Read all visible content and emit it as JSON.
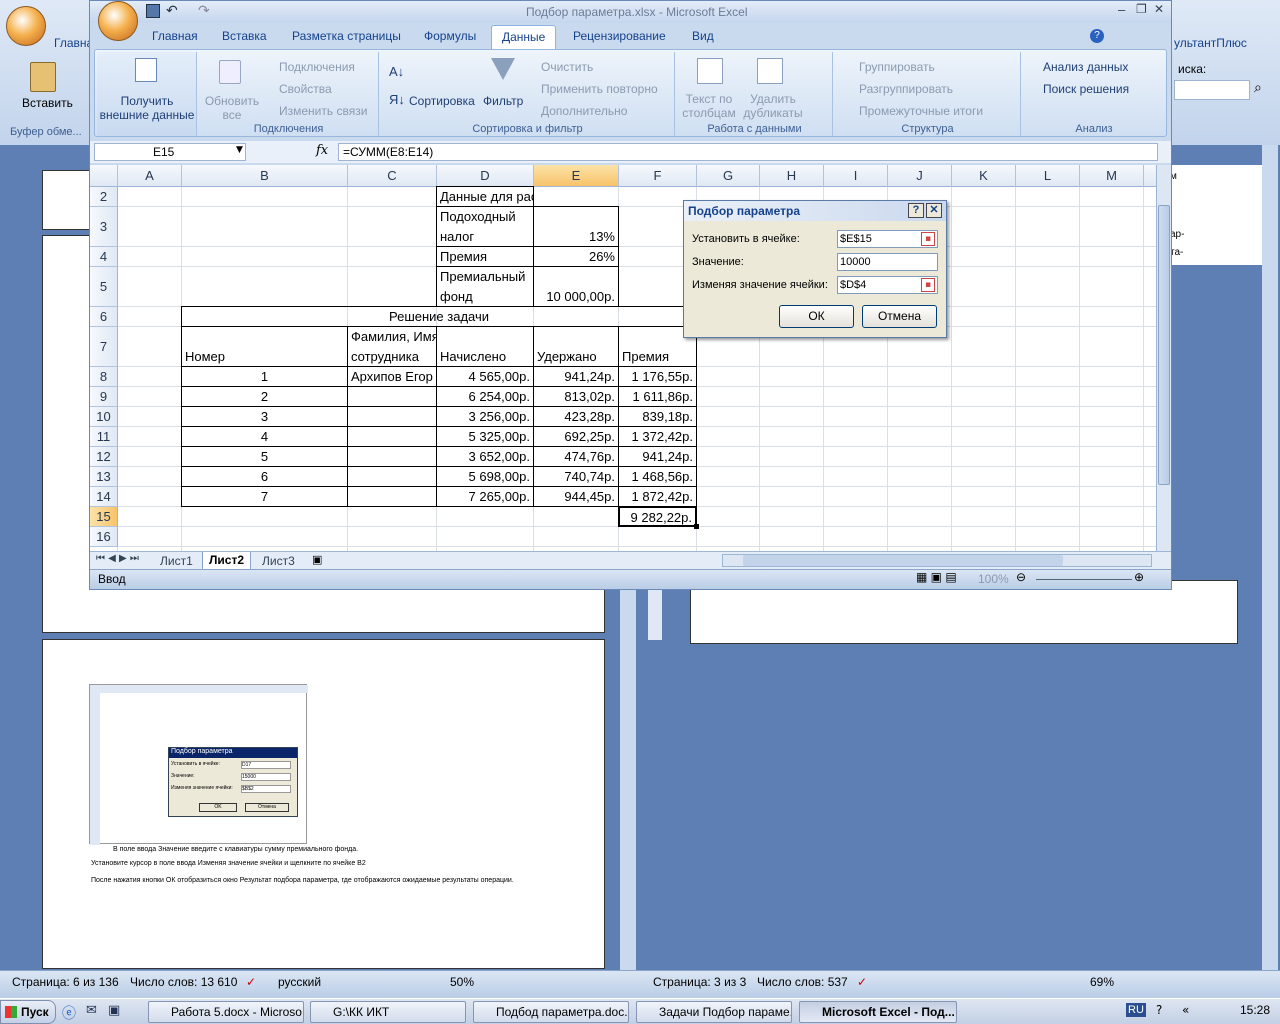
{
  "word_left": {
    "tab_home": "Главна",
    "paste_label": "Вставить",
    "clipboard_label": "Буфер обме...",
    "status": {
      "page": "Страница: 6 из 136",
      "words": "Число слов: 13 610",
      "language": "русский",
      "zoom": "50%"
    },
    "thumb": {
      "dialog_title": "Подбор параметра",
      "set_cell_label": "Установить в ячейке:",
      "set_cell_value": "D17",
      "value_label": "Значение:",
      "value_value": "15000",
      "changing_label": "Изменяя значение ячейки:",
      "changing_value": "$B$2",
      "ok": "OK",
      "cancel": "Отмена",
      "text1": "В поле ввода Значение введите с клавиатуры сумму премиального фонда.",
      "text2": "Установите курсор в поле ввода Изменяя значение ячейки и щелкните по ячейке В2",
      "text3": "После нажатия кнопки ОК отобразиться окно Результат подбора параметра, где отображаются ожидаемые результаты операции."
    }
  },
  "word_right": {
    "tab_frag": "ультантПлюс",
    "search_frag": "иска:",
    "side_text": [
      "м",
      "ар-",
      "та-"
    ],
    "status": {
      "page": "Страница: 3 из 3",
      "words": "Число слов: 537",
      "zoom": "69%"
    }
  },
  "excel": {
    "title": "Подбор параметра.xlsx - Microsoft Excel",
    "tabs": [
      "Главная",
      "Вставка",
      "Разметка страницы",
      "Формулы",
      "Данные",
      "Рецензирование",
      "Вид"
    ],
    "active_tab": "Данные",
    "ribbon": {
      "get_external": "Получить внешние данные",
      "refresh_all": "Обновить все",
      "connections": "Подключения",
      "properties": "Свойства",
      "edit_links": "Изменить связи",
      "group_connections": "Подключения",
      "sort": "Сортировка",
      "filter": "Фильтр",
      "clear": "Очистить",
      "reapply": "Применить повторно",
      "advanced": "Дополнительно",
      "group_sort": "Сортировка и фильтр",
      "text_to_columns": "Текст по столбцам",
      "remove_duplicates": "Удалить дубликаты",
      "group_data_tools": "Работа с данными",
      "group": "Группировать",
      "ungroup": "Разгруппировать",
      "subtotal": "Промежуточные итоги",
      "group_outline": "Структура",
      "data_analysis": "Анализ данных",
      "solver": "Поиск решения",
      "group_analysis": "Анализ"
    },
    "name_box": "E15",
    "fx": "fx",
    "formula": "=СУММ(E8:E14)",
    "columns": [
      "A",
      "B",
      "C",
      "D",
      "E",
      "F",
      "G",
      "H",
      "I",
      "J",
      "K",
      "L",
      "M",
      "N"
    ],
    "rows": [
      "2",
      "3",
      "4",
      "5",
      "6",
      "7",
      "8",
      "9",
      "10",
      "11",
      "12",
      "13",
      "14",
      "15",
      "16"
    ],
    "cells": {
      "c2": "Данные для расчетов",
      "c3a": "Подоходный",
      "c3b": "налог",
      "d3": "13%",
      "c4": "Премия",
      "d4": "26%",
      "c5a": "Премиальный",
      "c5b": "фонд",
      "d5": "10 000,00р.",
      "a6": "Решение задачи",
      "a7": "Номер",
      "b7a": "Фамилия, Имя, Отчество",
      "b7b": "сотрудника",
      "c7": "Начислено",
      "d7": "Удержано",
      "e7": "Премия",
      "e15": "9 282,22р."
    },
    "table_rows": [
      {
        "num": "1",
        "name": "Архипов Егор Сергеевич",
        "accrued": "4 565,00р.",
        "withheld": "941,24р.",
        "bonus": "1 176,55р."
      },
      {
        "num": "2",
        "name": "",
        "accrued": "6 254,00р.",
        "withheld": "813,02р.",
        "bonus": "1 611,86р."
      },
      {
        "num": "3",
        "name": "",
        "accrued": "3 256,00р.",
        "withheld": "423,28р.",
        "bonus": "839,18р."
      },
      {
        "num": "4",
        "name": "",
        "accrued": "5 325,00р.",
        "withheld": "692,25р.",
        "bonus": "1 372,42р."
      },
      {
        "num": "5",
        "name": "",
        "accrued": "3 652,00р.",
        "withheld": "474,76р.",
        "bonus": "941,24р."
      },
      {
        "num": "6",
        "name": "",
        "accrued": "5 698,00р.",
        "withheld": "740,74р.",
        "bonus": "1 468,56р."
      },
      {
        "num": "7",
        "name": "",
        "accrued": "7 265,00р.",
        "withheld": "944,45р.",
        "bonus": "1 872,42р."
      }
    ],
    "sheets": [
      "Лист1",
      "Лист2",
      "Лист3"
    ],
    "active_sheet": "Лист2",
    "status_mode": "Ввод",
    "zoom": "100%"
  },
  "dialog": {
    "title": "Подбор параметра",
    "help": "?",
    "close": "✕",
    "set_cell_label": "Установить в ячейке:",
    "set_cell_value": "$E$15",
    "value_label": "Значение:",
    "value_value": "10000",
    "changing_label": "Изменяя значение ячейки:",
    "changing_value": "$D$4",
    "ok": "ОК",
    "cancel": "Отмена"
  },
  "taskbar": {
    "start": "Пуск",
    "items": [
      "Работа 5.docx - Microso...",
      "G:\\КК ИКТ",
      "Подбод параметра.doc...",
      "Задачи Подбор параме...",
      "Microsoft Excel - Под..."
    ],
    "lang": "RU",
    "time": "15:28"
  },
  "colors": {
    "accent": "#15428b",
    "active_cell_header": "#f7c36b",
    "ribbon": "#cfdff2"
  }
}
